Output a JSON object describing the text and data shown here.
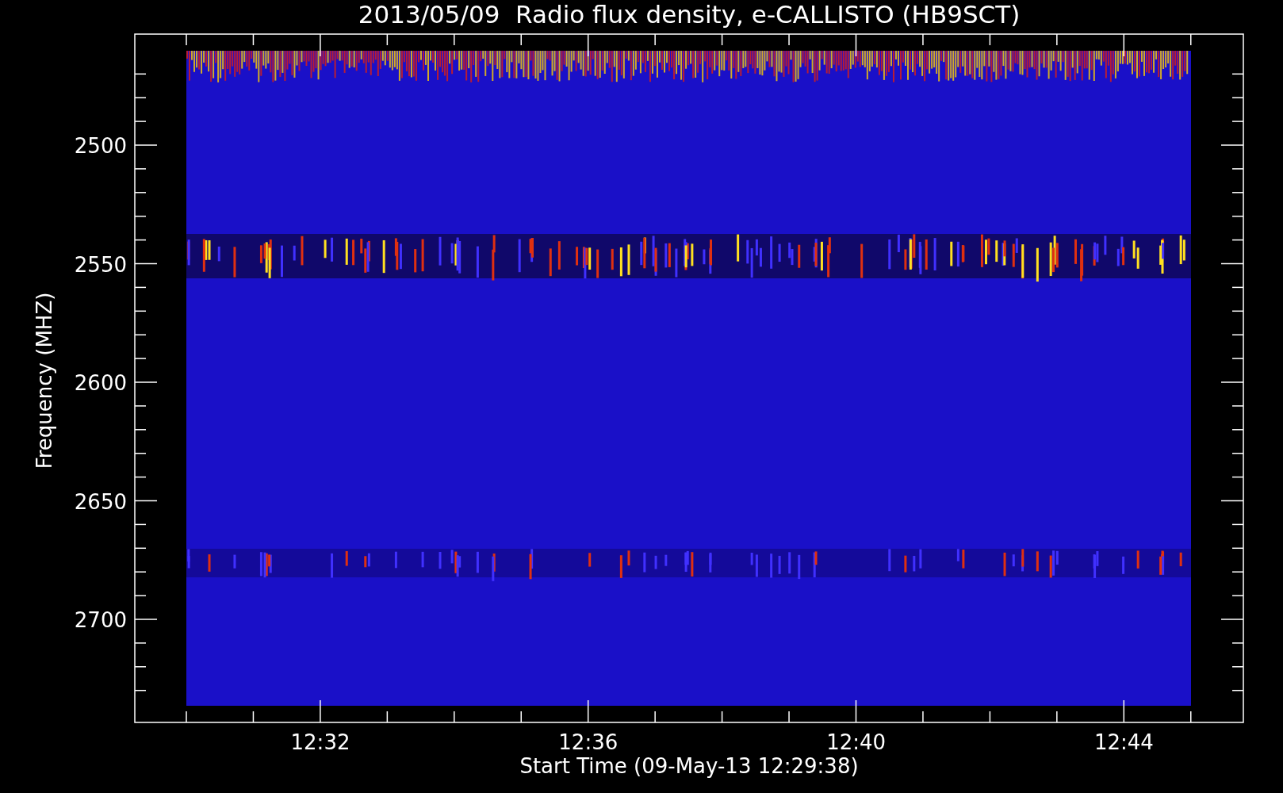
{
  "plot": {
    "title": "2013/05/09  Radio flux density, e-CALLISTO (HB9SCT)",
    "xlabel": "Start Time (09-May-13 12:29:38)",
    "ylabel": "Frequency (MHZ)",
    "yticks": [
      "2500",
      "2550",
      "2600",
      "2650",
      "2700"
    ],
    "xticks": [
      "12:32",
      "12:36",
      "12:40",
      "12:44"
    ]
  }
}
